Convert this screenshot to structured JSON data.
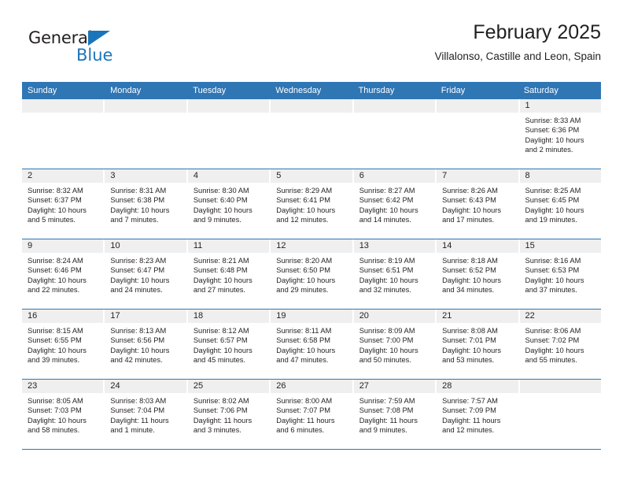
{
  "brand": {
    "name_top": "General",
    "name_bottom": "Blue",
    "accent_color": "#1b75bb"
  },
  "header": {
    "title": "February 2025",
    "subtitle": "Villalonso, Castille and Leon, Spain"
  },
  "theme": {
    "header_blue": "#2f76b5",
    "daynum_bg": "#efefef",
    "text": "#231f20"
  },
  "weekdays": [
    "Sunday",
    "Monday",
    "Tuesday",
    "Wednesday",
    "Thursday",
    "Friday",
    "Saturday"
  ],
  "weeks": [
    [
      {
        "day": "",
        "sunrise": "",
        "sunset": "",
        "daylight": ""
      },
      {
        "day": "",
        "sunrise": "",
        "sunset": "",
        "daylight": ""
      },
      {
        "day": "",
        "sunrise": "",
        "sunset": "",
        "daylight": ""
      },
      {
        "day": "",
        "sunrise": "",
        "sunset": "",
        "daylight": ""
      },
      {
        "day": "",
        "sunrise": "",
        "sunset": "",
        "daylight": ""
      },
      {
        "day": "",
        "sunrise": "",
        "sunset": "",
        "daylight": ""
      },
      {
        "day": "1",
        "sunrise": "Sunrise: 8:33 AM",
        "sunset": "Sunset: 6:36 PM",
        "daylight": "Daylight: 10 hours and 2 minutes."
      }
    ],
    [
      {
        "day": "2",
        "sunrise": "Sunrise: 8:32 AM",
        "sunset": "Sunset: 6:37 PM",
        "daylight": "Daylight: 10 hours and 5 minutes."
      },
      {
        "day": "3",
        "sunrise": "Sunrise: 8:31 AM",
        "sunset": "Sunset: 6:38 PM",
        "daylight": "Daylight: 10 hours and 7 minutes."
      },
      {
        "day": "4",
        "sunrise": "Sunrise: 8:30 AM",
        "sunset": "Sunset: 6:40 PM",
        "daylight": "Daylight: 10 hours and 9 minutes."
      },
      {
        "day": "5",
        "sunrise": "Sunrise: 8:29 AM",
        "sunset": "Sunset: 6:41 PM",
        "daylight": "Daylight: 10 hours and 12 minutes."
      },
      {
        "day": "6",
        "sunrise": "Sunrise: 8:27 AM",
        "sunset": "Sunset: 6:42 PM",
        "daylight": "Daylight: 10 hours and 14 minutes."
      },
      {
        "day": "7",
        "sunrise": "Sunrise: 8:26 AM",
        "sunset": "Sunset: 6:43 PM",
        "daylight": "Daylight: 10 hours and 17 minutes."
      },
      {
        "day": "8",
        "sunrise": "Sunrise: 8:25 AM",
        "sunset": "Sunset: 6:45 PM",
        "daylight": "Daylight: 10 hours and 19 minutes."
      }
    ],
    [
      {
        "day": "9",
        "sunrise": "Sunrise: 8:24 AM",
        "sunset": "Sunset: 6:46 PM",
        "daylight": "Daylight: 10 hours and 22 minutes."
      },
      {
        "day": "10",
        "sunrise": "Sunrise: 8:23 AM",
        "sunset": "Sunset: 6:47 PM",
        "daylight": "Daylight: 10 hours and 24 minutes."
      },
      {
        "day": "11",
        "sunrise": "Sunrise: 8:21 AM",
        "sunset": "Sunset: 6:48 PM",
        "daylight": "Daylight: 10 hours and 27 minutes."
      },
      {
        "day": "12",
        "sunrise": "Sunrise: 8:20 AM",
        "sunset": "Sunset: 6:50 PM",
        "daylight": "Daylight: 10 hours and 29 minutes."
      },
      {
        "day": "13",
        "sunrise": "Sunrise: 8:19 AM",
        "sunset": "Sunset: 6:51 PM",
        "daylight": "Daylight: 10 hours and 32 minutes."
      },
      {
        "day": "14",
        "sunrise": "Sunrise: 8:18 AM",
        "sunset": "Sunset: 6:52 PM",
        "daylight": "Daylight: 10 hours and 34 minutes."
      },
      {
        "day": "15",
        "sunrise": "Sunrise: 8:16 AM",
        "sunset": "Sunset: 6:53 PM",
        "daylight": "Daylight: 10 hours and 37 minutes."
      }
    ],
    [
      {
        "day": "16",
        "sunrise": "Sunrise: 8:15 AM",
        "sunset": "Sunset: 6:55 PM",
        "daylight": "Daylight: 10 hours and 39 minutes."
      },
      {
        "day": "17",
        "sunrise": "Sunrise: 8:13 AM",
        "sunset": "Sunset: 6:56 PM",
        "daylight": "Daylight: 10 hours and 42 minutes."
      },
      {
        "day": "18",
        "sunrise": "Sunrise: 8:12 AM",
        "sunset": "Sunset: 6:57 PM",
        "daylight": "Daylight: 10 hours and 45 minutes."
      },
      {
        "day": "19",
        "sunrise": "Sunrise: 8:11 AM",
        "sunset": "Sunset: 6:58 PM",
        "daylight": "Daylight: 10 hours and 47 minutes."
      },
      {
        "day": "20",
        "sunrise": "Sunrise: 8:09 AM",
        "sunset": "Sunset: 7:00 PM",
        "daylight": "Daylight: 10 hours and 50 minutes."
      },
      {
        "day": "21",
        "sunrise": "Sunrise: 8:08 AM",
        "sunset": "Sunset: 7:01 PM",
        "daylight": "Daylight: 10 hours and 53 minutes."
      },
      {
        "day": "22",
        "sunrise": "Sunrise: 8:06 AM",
        "sunset": "Sunset: 7:02 PM",
        "daylight": "Daylight: 10 hours and 55 minutes."
      }
    ],
    [
      {
        "day": "23",
        "sunrise": "Sunrise: 8:05 AM",
        "sunset": "Sunset: 7:03 PM",
        "daylight": "Daylight: 10 hours and 58 minutes."
      },
      {
        "day": "24",
        "sunrise": "Sunrise: 8:03 AM",
        "sunset": "Sunset: 7:04 PM",
        "daylight": "Daylight: 11 hours and 1 minute."
      },
      {
        "day": "25",
        "sunrise": "Sunrise: 8:02 AM",
        "sunset": "Sunset: 7:06 PM",
        "daylight": "Daylight: 11 hours and 3 minutes."
      },
      {
        "day": "26",
        "sunrise": "Sunrise: 8:00 AM",
        "sunset": "Sunset: 7:07 PM",
        "daylight": "Daylight: 11 hours and 6 minutes."
      },
      {
        "day": "27",
        "sunrise": "Sunrise: 7:59 AM",
        "sunset": "Sunset: 7:08 PM",
        "daylight": "Daylight: 11 hours and 9 minutes."
      },
      {
        "day": "28",
        "sunrise": "Sunrise: 7:57 AM",
        "sunset": "Sunset: 7:09 PM",
        "daylight": "Daylight: 11 hours and 12 minutes."
      },
      {
        "day": "",
        "sunrise": "",
        "sunset": "",
        "daylight": ""
      }
    ]
  ]
}
